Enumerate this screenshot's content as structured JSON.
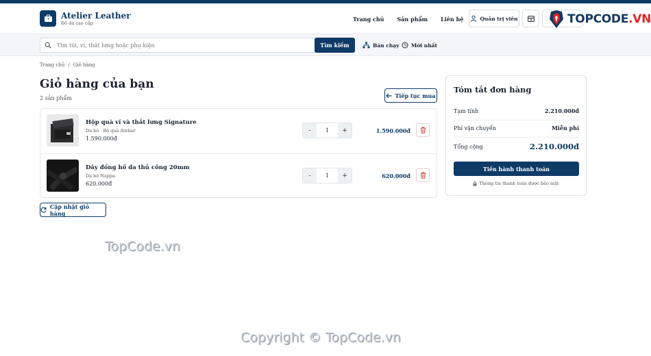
{
  "header": {
    "brand_name": "Atelier Leather",
    "brand_tagline": "Đồ da cao cấp",
    "nav": [
      "Trang chủ",
      "Sản phẩm",
      "Liên hệ"
    ],
    "admin_label": "Quản trị viên"
  },
  "search": {
    "placeholder": "Tìm túi, ví, thắt lưng hoặc phụ kiện",
    "button_label": "Tìm kiếm",
    "bestseller_label": "Bán chạy",
    "newest_label": "Mới nhất"
  },
  "breadcrumb": {
    "home": "Trang chủ",
    "separator": "/",
    "current": "Giỏ hàng"
  },
  "page": {
    "title": "Giỏ hàng của bạn",
    "item_count": "2 sản phẩm",
    "continue_label": "Tiếp tục mua",
    "update_label": "Cập nhật giỏ hàng"
  },
  "cart": {
    "items": [
      {
        "name": "Hộp quà ví và thắt lưng Signature",
        "material": "Da bò",
        "category": "Bộ quà Atelier",
        "unit_price": "1.590.000đ",
        "qty": "1",
        "line_total": "1.590.000đ"
      },
      {
        "name": "Dây đồng hồ da thủ công 20mm",
        "material": "Da bò Nappa",
        "category": "",
        "unit_price": "620.000đ",
        "qty": "1",
        "line_total": "620.000đ"
      }
    ],
    "minus": "-",
    "plus": "+"
  },
  "summary": {
    "title": "Tóm tắt đơn hàng",
    "subtotal_label": "Tạm tính",
    "subtotal_value": "2.210.000đ",
    "shipping_label": "Phí vận chuyển",
    "shipping_value": "Miễn phí",
    "total_label": "Tổng cộng",
    "total_value": "2.210.000đ",
    "checkout_label": "Tiến hành thanh toán",
    "secure_note": "Thông tin thanh toán được bảo mật"
  },
  "watermarks": {
    "logo_text_a": "TOPCODE",
    "logo_text_b": ".VN",
    "center": "TopCode.vn",
    "footer": "Copyright © TopCode.vn"
  },
  "colors": {
    "primary": "#0e3a66",
    "danger": "#c0392b",
    "border": "#e2e6eb"
  }
}
